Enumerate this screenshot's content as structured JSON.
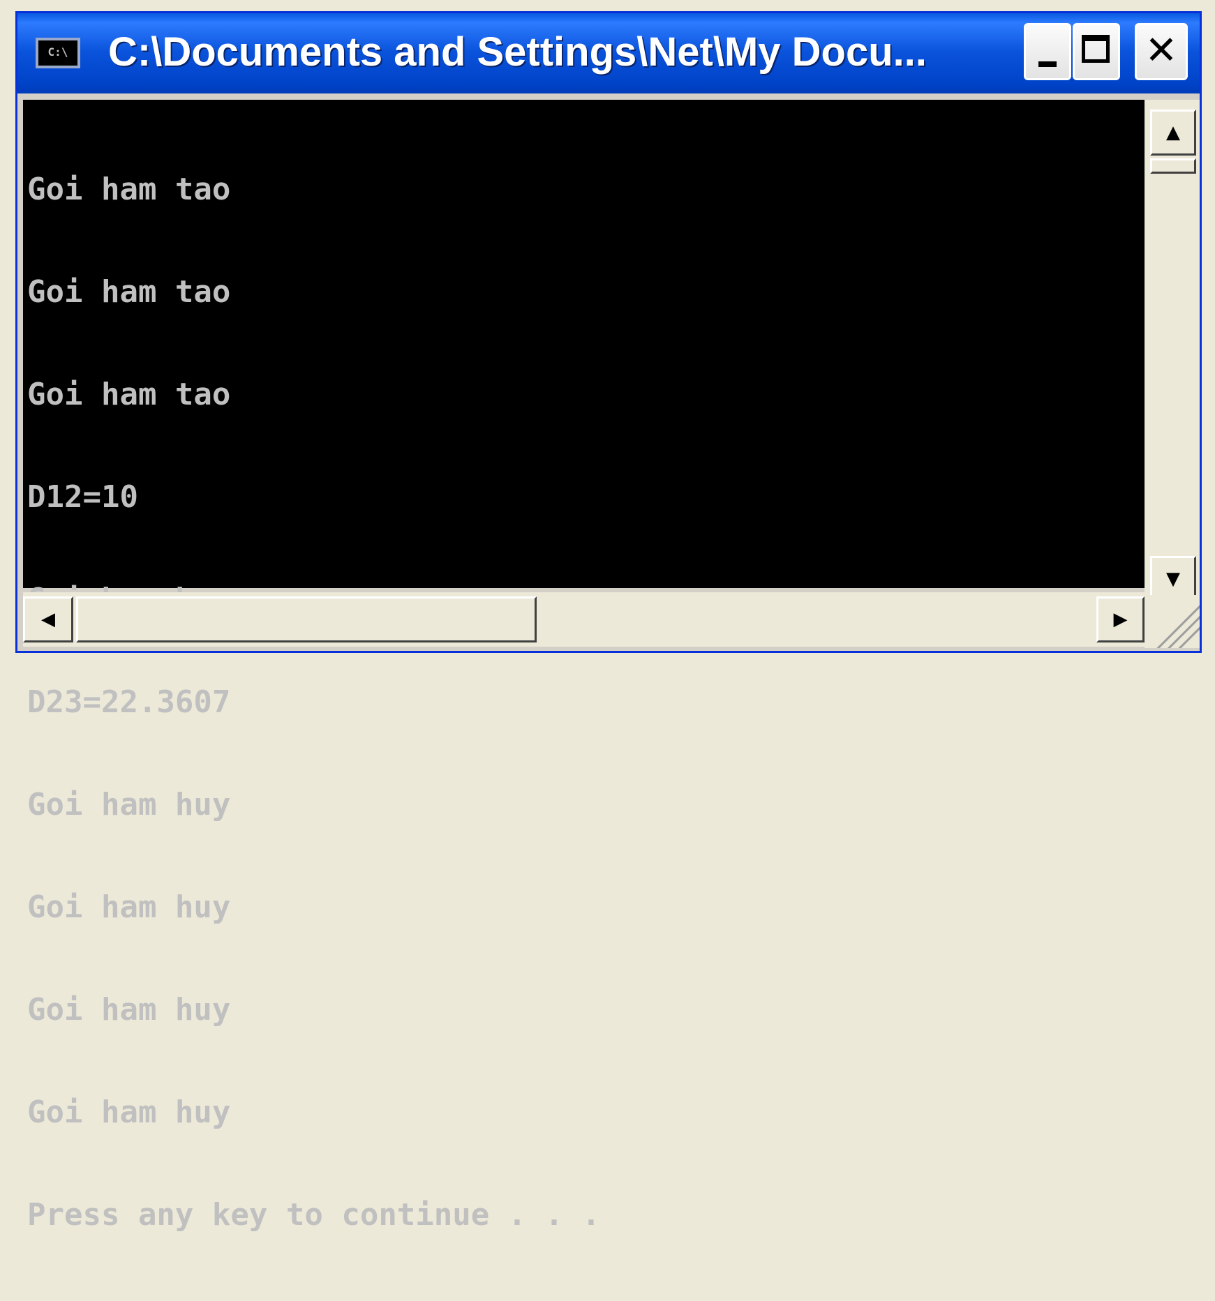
{
  "window": {
    "title": "C:\\Documents and Settings\\Net\\My Docu...",
    "icon_text": "C:\\",
    "icon": "command-prompt-icon",
    "buttons": {
      "minimize": "minimize-icon",
      "maximize": "maximize-icon",
      "close_glyph": "✕"
    }
  },
  "console": {
    "lines": [
      "Goi ham tao",
      "Goi ham tao",
      "Goi ham tao",
      "D12=10",
      "Goi ham huy",
      "D23=22.3607",
      "Goi ham huy",
      "Goi ham huy",
      "Goi ham huy",
      "Goi ham huy",
      "Press any key to continue . . ."
    ]
  },
  "scrollbars": {
    "up_arrow": "▲",
    "down_arrow": "▼",
    "left_arrow": "◀",
    "right_arrow": "▶"
  },
  "colors": {
    "titlebar": "#0a53db",
    "console_bg": "#000000",
    "console_fg": "#c0c0c0"
  }
}
